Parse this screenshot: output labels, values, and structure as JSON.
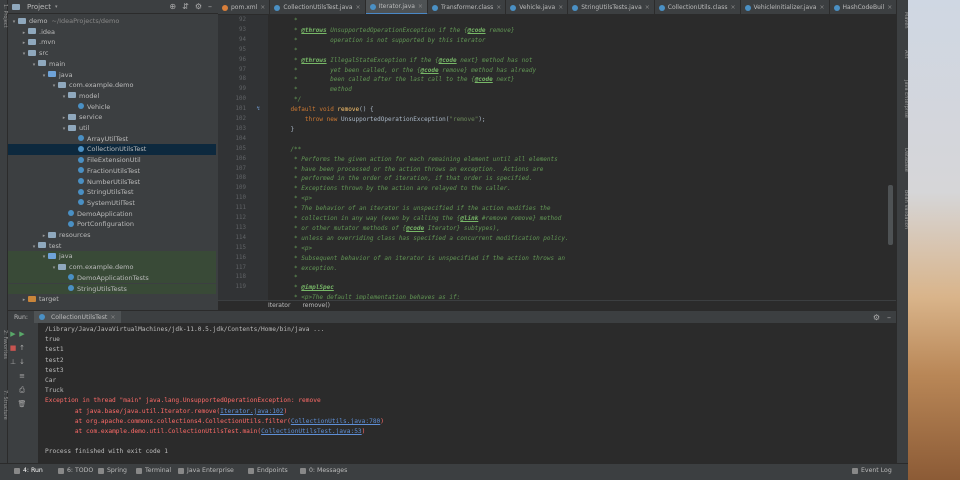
{
  "left_strip": {
    "labels": [
      "1: Project",
      "2: Favorites",
      "7: Structure"
    ]
  },
  "project_panel": {
    "title": "Project",
    "tree": [
      {
        "label": "demo",
        "suffix": "~/IdeaProjects/demo",
        "indent": 0,
        "icon": "folder",
        "arrow": "▾"
      },
      {
        "label": ".idea",
        "indent": 1,
        "icon": "folder",
        "arrow": "▸"
      },
      {
        "label": ".mvn",
        "indent": 1,
        "icon": "folder",
        "arrow": "▸"
      },
      {
        "label": "src",
        "indent": 1,
        "icon": "folder",
        "arrow": "▾"
      },
      {
        "label": "main",
        "indent": 2,
        "icon": "folder",
        "arrow": "▾"
      },
      {
        "label": "java",
        "indent": 3,
        "icon": "folder-blue",
        "arrow": "▾"
      },
      {
        "label": "com.example.demo",
        "indent": 4,
        "icon": "folder",
        "arrow": "▾"
      },
      {
        "label": "model",
        "indent": 5,
        "icon": "folder",
        "arrow": "▾"
      },
      {
        "label": "Vehicle",
        "indent": 6,
        "icon": "class",
        "arrow": ""
      },
      {
        "label": "service",
        "indent": 5,
        "icon": "folder",
        "arrow": "▸"
      },
      {
        "label": "util",
        "indent": 5,
        "icon": "folder",
        "arrow": "▾"
      },
      {
        "label": "ArrayUtilTest",
        "indent": 6,
        "icon": "class",
        "arrow": ""
      },
      {
        "label": "CollectionUtilsTest",
        "indent": 6,
        "icon": "class",
        "arrow": "",
        "selected": true
      },
      {
        "label": "FileExtensionUtil",
        "indent": 6,
        "icon": "class",
        "arrow": ""
      },
      {
        "label": "FractionUtilsTest",
        "indent": 6,
        "icon": "class",
        "arrow": ""
      },
      {
        "label": "NumberUtilsTest",
        "indent": 6,
        "icon": "class",
        "arrow": ""
      },
      {
        "label": "StringUtilsTest",
        "indent": 6,
        "icon": "class",
        "arrow": ""
      },
      {
        "label": "SystemUtilTest",
        "indent": 6,
        "icon": "class",
        "arrow": ""
      },
      {
        "label": "DemoApplication",
        "indent": 5,
        "icon": "class",
        "arrow": ""
      },
      {
        "label": "PortConfiguration",
        "indent": 5,
        "icon": "class",
        "arrow": ""
      },
      {
        "label": "resources",
        "indent": 3,
        "icon": "folder",
        "arrow": "▸"
      },
      {
        "label": "test",
        "indent": 2,
        "icon": "folder",
        "arrow": "▾"
      },
      {
        "label": "java",
        "indent": 3,
        "icon": "folder-blue",
        "arrow": "▾",
        "test": true
      },
      {
        "label": "com.example.demo",
        "indent": 4,
        "icon": "folder",
        "arrow": "▾",
        "test": true
      },
      {
        "label": "DemoApplicationTests",
        "indent": 5,
        "icon": "class",
        "arrow": "",
        "test": true
      },
      {
        "label": "StringUtilsTests",
        "indent": 5,
        "icon": "class",
        "arrow": "",
        "test": true
      },
      {
        "label": "target",
        "indent": 1,
        "icon": "folder-orange",
        "arrow": "▸"
      }
    ]
  },
  "tabs": [
    {
      "label": "pom.xml",
      "icon": "maven"
    },
    {
      "label": "CollectionUtilsTest.java",
      "icon": "class"
    },
    {
      "label": "Iterator.java",
      "icon": "class",
      "active": true
    },
    {
      "label": "Transformer.class",
      "icon": "class"
    },
    {
      "label": "Vehicle.java",
      "icon": "class"
    },
    {
      "label": "StringUtilsTests.java",
      "icon": "class"
    },
    {
      "label": "CollectionUtils.class",
      "icon": "class"
    },
    {
      "label": "VehicleInitializer.java",
      "icon": "class"
    },
    {
      "label": "HashCodeBuil",
      "icon": "class"
    }
  ],
  "editor": {
    "line_numbers": [
      "92",
      "93",
      "94",
      "95",
      "96",
      "97",
      "98",
      "99",
      "100",
      "101",
      "102",
      "103",
      "104",
      "105",
      "106",
      "107",
      "108",
      "109",
      "110",
      "111",
      "112",
      "113",
      "114",
      "115",
      "116",
      "117",
      "118",
      "119"
    ],
    "lines": [
      [
        {
          "t": "     *",
          "c": "doc"
        }
      ],
      [
        {
          "t": "     * ",
          "c": "doc"
        },
        {
          "t": "@throws",
          "c": "tag"
        },
        {
          "t": " UnsupportedOperationException if the {",
          "c": "doc"
        },
        {
          "t": "@code",
          "c": "tag"
        },
        {
          "t": " remove}",
          "c": "doc"
        }
      ],
      [
        {
          "t": "     *         operation is not supported by this iterator",
          "c": "doc"
        }
      ],
      [
        {
          "t": "     *",
          "c": "doc"
        }
      ],
      [
        {
          "t": "     * ",
          "c": "doc"
        },
        {
          "t": "@throws",
          "c": "tag"
        },
        {
          "t": " IllegalStateException if the {",
          "c": "doc"
        },
        {
          "t": "@code",
          "c": "tag"
        },
        {
          "t": " next} method has not",
          "c": "doc"
        }
      ],
      [
        {
          "t": "     *         yet been called, or the {",
          "c": "doc"
        },
        {
          "t": "@code",
          "c": "tag"
        },
        {
          "t": " remove} method has already",
          "c": "doc"
        }
      ],
      [
        {
          "t": "     *         been called after the last call to the {",
          "c": "doc"
        },
        {
          "t": "@code",
          "c": "tag"
        },
        {
          "t": " next}",
          "c": "doc"
        }
      ],
      [
        {
          "t": "     *         method",
          "c": "doc"
        }
      ],
      [
        {
          "t": "     */",
          "c": "doc"
        }
      ],
      [
        {
          "t": "    ",
          "c": "plain"
        },
        {
          "t": "default void ",
          "c": "kw"
        },
        {
          "t": "remove",
          "c": "fn"
        },
        {
          "t": "() {",
          "c": "plain"
        }
      ],
      [
        {
          "t": "        ",
          "c": "plain"
        },
        {
          "t": "throw new ",
          "c": "kw"
        },
        {
          "t": "UnsupportedOperationException(",
          "c": "plain"
        },
        {
          "t": "\"remove\"",
          "c": "str"
        },
        {
          "t": ");",
          "c": "plain"
        }
      ],
      [
        {
          "t": "    }",
          "c": "plain"
        }
      ],
      [
        {
          "t": "",
          "c": "plain"
        }
      ],
      [
        {
          "t": "    /**",
          "c": "doc"
        }
      ],
      [
        {
          "t": "     * Performs the given action for each remaining element until all elements",
          "c": "doc"
        }
      ],
      [
        {
          "t": "     * have been processed or the action throws an exception.  Actions are",
          "c": "doc"
        }
      ],
      [
        {
          "t": "     * performed in the order of iteration, if that order is specified.",
          "c": "doc"
        }
      ],
      [
        {
          "t": "     * Exceptions thrown by the action are relayed to the caller.",
          "c": "doc"
        }
      ],
      [
        {
          "t": "     * <p>",
          "c": "doc"
        }
      ],
      [
        {
          "t": "     * The behavior of an iterator is unspecified if the action modifies the",
          "c": "doc"
        }
      ],
      [
        {
          "t": "     * collection in any way (even by calling the {",
          "c": "doc"
        },
        {
          "t": "@link",
          "c": "tag"
        },
        {
          "t": " #remove remove} method",
          "c": "doc"
        }
      ],
      [
        {
          "t": "     * or other mutator methods of {",
          "c": "doc"
        },
        {
          "t": "@code",
          "c": "tag"
        },
        {
          "t": " Iterator} subtypes),",
          "c": "doc"
        }
      ],
      [
        {
          "t": "     * unless an overriding class has specified a concurrent modification policy.",
          "c": "doc"
        }
      ],
      [
        {
          "t": "     * <p>",
          "c": "doc"
        }
      ],
      [
        {
          "t": "     * Subsequent behavior of an iterator is unspecified if the action throws an",
          "c": "doc"
        }
      ],
      [
        {
          "t": "     * exception.",
          "c": "doc"
        }
      ],
      [
        {
          "t": "     *",
          "c": "doc"
        }
      ],
      [
        {
          "t": "     * ",
          "c": "doc"
        },
        {
          "t": "@implSpec",
          "c": "tag"
        }
      ],
      [
        {
          "t": "     * <p>The default implementation behaves as if:",
          "c": "doc"
        }
      ]
    ]
  },
  "breadcrumb": [
    "Iterator",
    "remove()"
  ],
  "run": {
    "label": "Run:",
    "tab": "CollectionUtilsTest",
    "console": [
      {
        "t": "/Library/Java/JavaVirtualMachines/jdk-11.0.5.jdk/Contents/Home/bin/java ...",
        "c": "out"
      },
      {
        "t": "true",
        "c": "out"
      },
      {
        "t": "test1",
        "c": "out"
      },
      {
        "t": "test2",
        "c": "out"
      },
      {
        "t": "test3",
        "c": "out"
      },
      {
        "t": "Car",
        "c": "out"
      },
      {
        "t": "Truck",
        "c": "out"
      },
      {
        "t": "Exception in thread \"main\" java.lang.UnsupportedOperationException: remove",
        "c": "err"
      },
      {
        "t": "\tat java.base/java.util.Iterator.remove(",
        "c": "err",
        "link": "Iterator.java:102",
        "tail": ")"
      },
      {
        "t": "\tat org.apache.commons.collections4.CollectionUtils.filter(",
        "c": "err",
        "link": "CollectionUtils.java:780",
        "tail": ")"
      },
      {
        "t": "\tat com.example.demo.util.CollectionUtilsTest.main(",
        "c": "err",
        "link": "CollectionUtilsTest.java:53",
        "tail": ")"
      },
      {
        "t": "",
        "c": "out"
      },
      {
        "t": "Process finished with exit code 1",
        "c": "out"
      }
    ]
  },
  "right_strip": {
    "labels": [
      "Maven",
      "Ant",
      "Java Enterprise",
      "Database",
      "Bean Validation"
    ]
  },
  "bottom_tools": [
    {
      "label": "4: Run",
      "active": true
    },
    {
      "label": "6: TODO"
    },
    {
      "label": "Spring"
    },
    {
      "label": "Terminal"
    },
    {
      "label": "Java Enterprise"
    },
    {
      "label": "Endpoints"
    },
    {
      "label": "0: Messages"
    }
  ],
  "event_log": "Event Log"
}
